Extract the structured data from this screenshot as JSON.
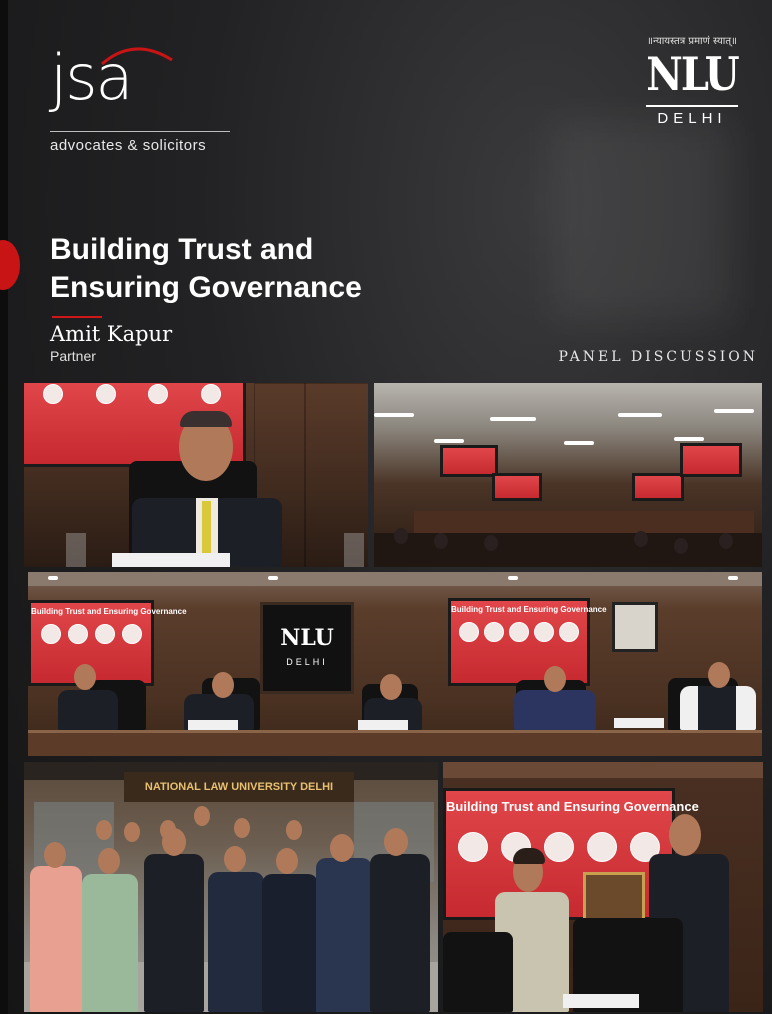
{
  "brand": {
    "logo_text": "jsa",
    "tagline": "advocates & solicitors",
    "accent_color": "#c81414"
  },
  "partner": {
    "motto": "॥न्यायस्तत्र प्रमाणं स्यात्॥",
    "logo_text": "NLU",
    "city": "DELHI"
  },
  "title": {
    "line1": "Building Trust and",
    "line2": "Ensuring Governance"
  },
  "speaker": {
    "name": "Amit Kapur",
    "role": "Partner"
  },
  "event_type": "PANEL DISCUSSION",
  "photos": {
    "screen_title": "Building Trust and Ensuring Governance",
    "stage_logo_text": "NLU",
    "stage_logo_city": "DELHI",
    "building_sign": "NATIONAL LAW UNIVERSITY DELHI"
  }
}
